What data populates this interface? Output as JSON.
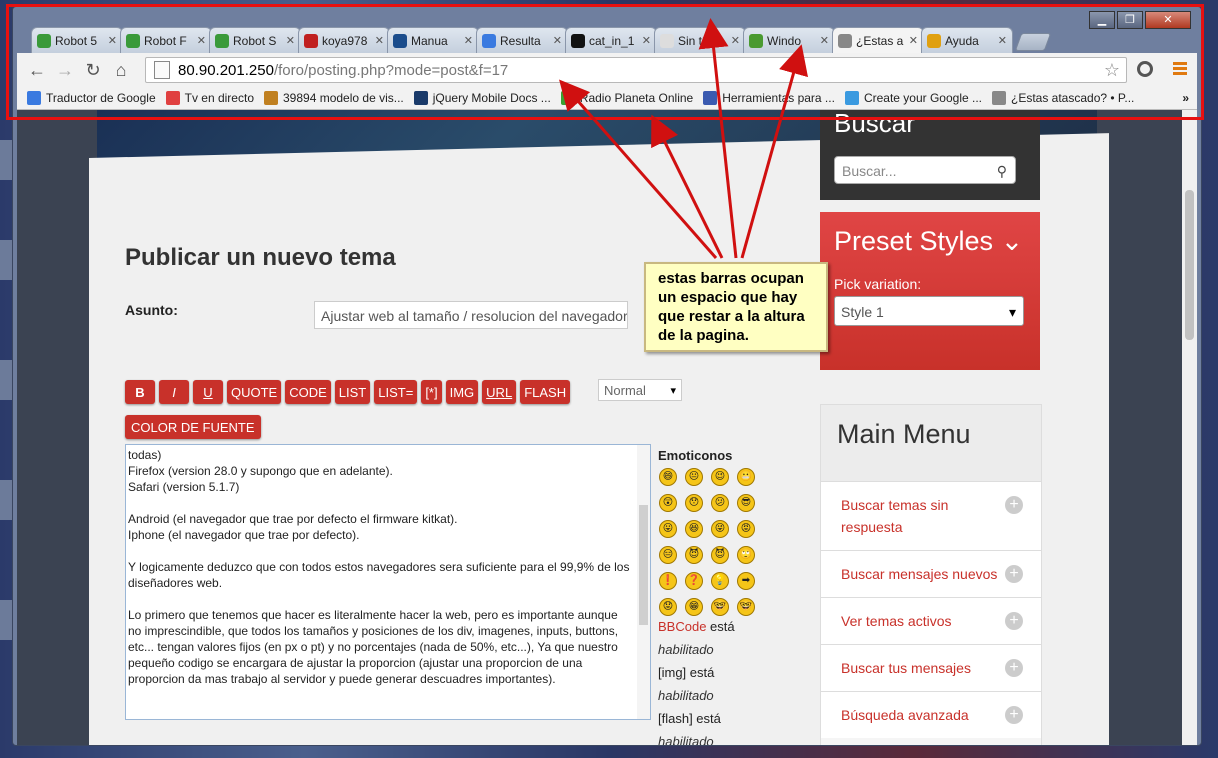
{
  "browser": {
    "window_controls": [
      "▁",
      "❐",
      "✕"
    ],
    "tabs": [
      {
        "title": "Robot 5",
        "icon": "chrome-icon",
        "color": "#3a9a3a"
      },
      {
        "title": "Robot F",
        "icon": "chrome-icon",
        "color": "#3a9a3a"
      },
      {
        "title": "Robot S",
        "icon": "chrome-icon",
        "color": "#3a9a3a"
      },
      {
        "title": "koya978",
        "icon": "red-icon",
        "color": "#c02020"
      },
      {
        "title": "Manua",
        "icon": "s-icon",
        "color": "#1a4c8c"
      },
      {
        "title": "Resulta",
        "icon": "google-icon",
        "color": "#3a7ae0"
      },
      {
        "title": "cat_in_1",
        "icon": "black-icon",
        "color": "#111111"
      },
      {
        "title": "Sin títul",
        "icon": "doc-icon",
        "color": "#dddddd"
      },
      {
        "title": "Windo",
        "icon": "green-icon",
        "color": "#4a9a30"
      },
      {
        "title": "¿Estas a",
        "icon": "figure-icon",
        "color": "#888888"
      },
      {
        "title": "Ayuda",
        "icon": "chrome-icon",
        "color": "#e0a010"
      }
    ],
    "active_tab": 9,
    "url_host": "80.90.201.250",
    "url_path": "/foro/posting.php?mode=post&f=17",
    "bookmarks": [
      {
        "label": "Traductor de Google",
        "color": "#3a7ae0"
      },
      {
        "label": "Tv en directo",
        "color": "#e04040"
      },
      {
        "label": "39894 modelo de vis...",
        "color": "#c08020"
      },
      {
        "label": "jQuery Mobile Docs ...",
        "color": "#1a3a6a"
      },
      {
        "label": "Radio Planeta Online",
        "color": "#3aa030"
      },
      {
        "label": "Herramientas para ...",
        "color": "#3a5ab0"
      },
      {
        "label": "Create your Google ...",
        "color": "#3a9ae0"
      },
      {
        "label": "¿Estas atascado? • P...",
        "color": "#888888"
      }
    ],
    "bookmarks_more": "»"
  },
  "page": {
    "title": "Publicar un nuevo tema",
    "subject_label": "Asunto:",
    "subject_value": "Ajustar web al tamaño / resolucion del navegador",
    "bbcode_buttons": [
      "B",
      "I",
      "U",
      "QUOTE",
      "CODE",
      "LIST",
      "LIST=",
      "[*]",
      "IMG",
      "URL",
      "FLASH"
    ],
    "font_size_select": "Normal",
    "color_button": "COLOR DE FUENTE",
    "editor_lines": [
      "todas)",
      "Firefox (version 28.0  y supongo que en adelante).",
      "Safari (version 5.1.7)",
      "",
      "Android (el navegador que trae por defecto el firmware kitkat).",
      "Iphone (el navegador que trae por defecto).",
      "",
      "Y logicamente deduzco que con todos estos navegadores sera suficiente para el 99,9% de los diseñadores web.",
      "",
      "Lo primero que tenemos que hacer es literalmente hacer la web, pero es importante aunque no imprescindible, que todos los tamaños y posiciones de los div, imagenes, inputs, buttons, etc... tengan valores fijos (en px o pt) y no porcentajes (nada de 50%, etc...), Ya que nuestro pequeño codigo se encargara de ajustar la proporcion (ajustar una proporcion de una proporcion da mas trabajo al servidor y puede generar descuadres importantes)."
    ],
    "emoticons_title": "Emoticonos",
    "emoticons": [
      "😄",
      "😐",
      "😉",
      "😬",
      "😲",
      "😯",
      "😕",
      "😎",
      "😛",
      "😆",
      "😜",
      "😡",
      "😑",
      "😈",
      "😈",
      "🙄",
      "❗",
      "❓",
      "💡",
      "➡",
      "😟",
      "😁",
      "🤓",
      "🤓"
    ],
    "bbinfo": [
      {
        "a": "BBCode",
        "b": " está",
        "c": "habilitado"
      },
      {
        "a": "[img]",
        "b": " está",
        "c": "habilitado"
      },
      {
        "a": "[flash]",
        "b": " está",
        "c": "habilitado"
      }
    ]
  },
  "sidebar": {
    "search_title": "Buscar",
    "search_placeholder": "Buscar...",
    "preset_title": "Preset Styles",
    "pick_label": "Pick variation:",
    "style_value": "Style 1",
    "menu_title": "Main Menu",
    "menu_items": [
      "Buscar temas sin respuesta",
      "Buscar mensajes nuevos",
      "Ver temas activos",
      "Buscar tus mensajes",
      "Búsqueda avanzada"
    ]
  },
  "annotation": {
    "text": "estas barras ocupan un espacio que hay que restar a la altura de la pagina."
  },
  "colors": {
    "accent_red": "#c8312a",
    "highlight_frame": "#e81010",
    "note_bg": "#ffffc2"
  }
}
